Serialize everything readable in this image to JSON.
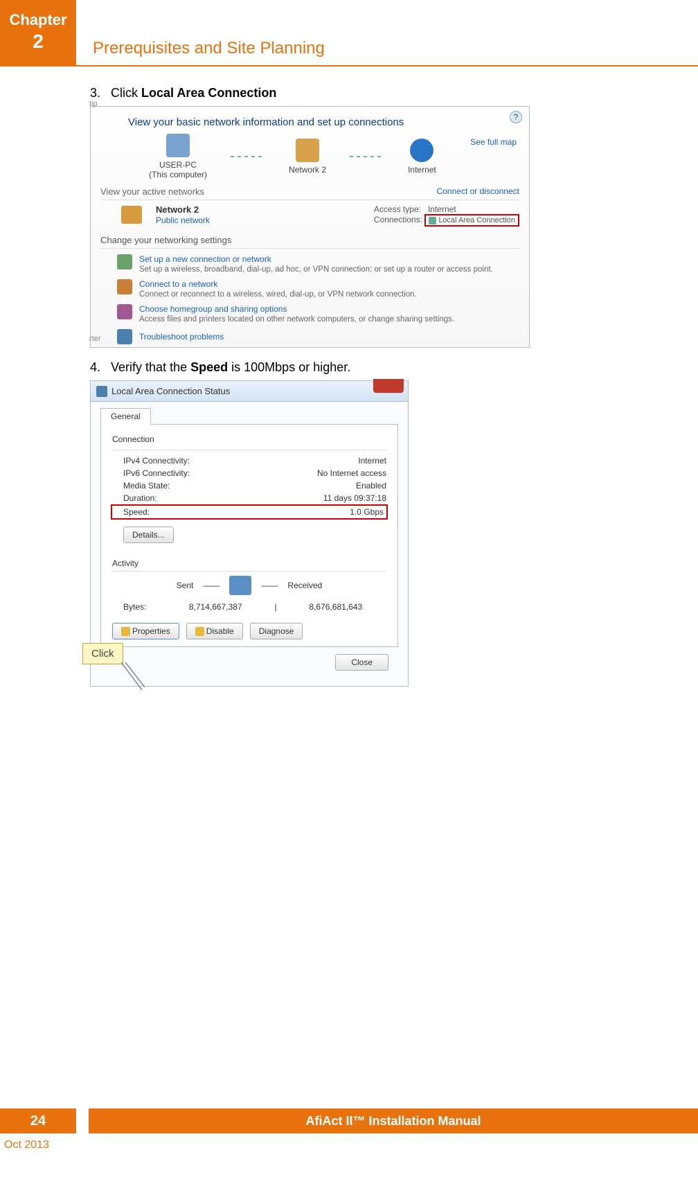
{
  "header": {
    "chapterWord": "Chapter",
    "chapterNum": "2",
    "title": "Prerequisites and Site Planning"
  },
  "steps": {
    "s3_num": "3.",
    "s3_pre": "Click ",
    "s3_bold": "Local Area Connection",
    "s4_num": "4.",
    "s4_pre": "Verify that the ",
    "s4_bold": "Speed",
    "s4_post": " is 100Mbps or higher."
  },
  "fig1": {
    "cornerTop": "tip",
    "cornerLeft": "rter",
    "heading": "View your basic network information and set up connections",
    "fullMap": "See full map",
    "node1": "USER-PC",
    "node1sub": "(This computer)",
    "node2": "Network  2",
    "node3": "Internet",
    "activeLabel": "View your active networks",
    "connDisc": "Connect or disconnect",
    "netName": "Network  2",
    "netType": "Public network",
    "accessTypeLabel": "Access type:",
    "accessTypeVal": "Internet",
    "connectionsLabel": "Connections:",
    "lac": "Local Area Connection",
    "changeLabel": "Change your networking settings",
    "opt1": "Set up a new connection or network",
    "opt1d": "Set up a wireless, broadband, dial-up, ad hoc, or VPN connection; or set up a router or access point.",
    "opt2": "Connect to a network",
    "opt2d": "Connect or reconnect to a wireless, wired, dial-up, or VPN network connection.",
    "opt3": "Choose homegroup and sharing options",
    "opt3d": "Access files and printers located on other network computers, or change sharing settings.",
    "trouble": "Troubleshoot problems"
  },
  "fig2": {
    "title": "Local Area Connection Status",
    "tab": "General",
    "connLabel": "Connection",
    "rows": [
      {
        "k": "IPv4 Connectivity:",
        "v": "Internet"
      },
      {
        "k": "IPv6 Connectivity:",
        "v": "No Internet access"
      },
      {
        "k": "Media State:",
        "v": "Enabled"
      },
      {
        "k": "Duration:",
        "v": "11 days 09:37:18"
      }
    ],
    "speedK": "Speed:",
    "speedV": "1.0 Gbps",
    "details": "Details...",
    "activityLabel": "Activity",
    "sent": "Sent",
    "received": "Received",
    "bytesLabel": "Bytes:",
    "bytesSent": "8,714,667,387",
    "bytesRecv": "8,676,681,643",
    "properties": "Properties",
    "disable": "Disable",
    "diagnose": "Diagnose",
    "close": "Close",
    "callout": "Click"
  },
  "footer": {
    "page": "24",
    "manual": "AfiAct II™ Installation Manual",
    "date": "Oct 2013"
  }
}
